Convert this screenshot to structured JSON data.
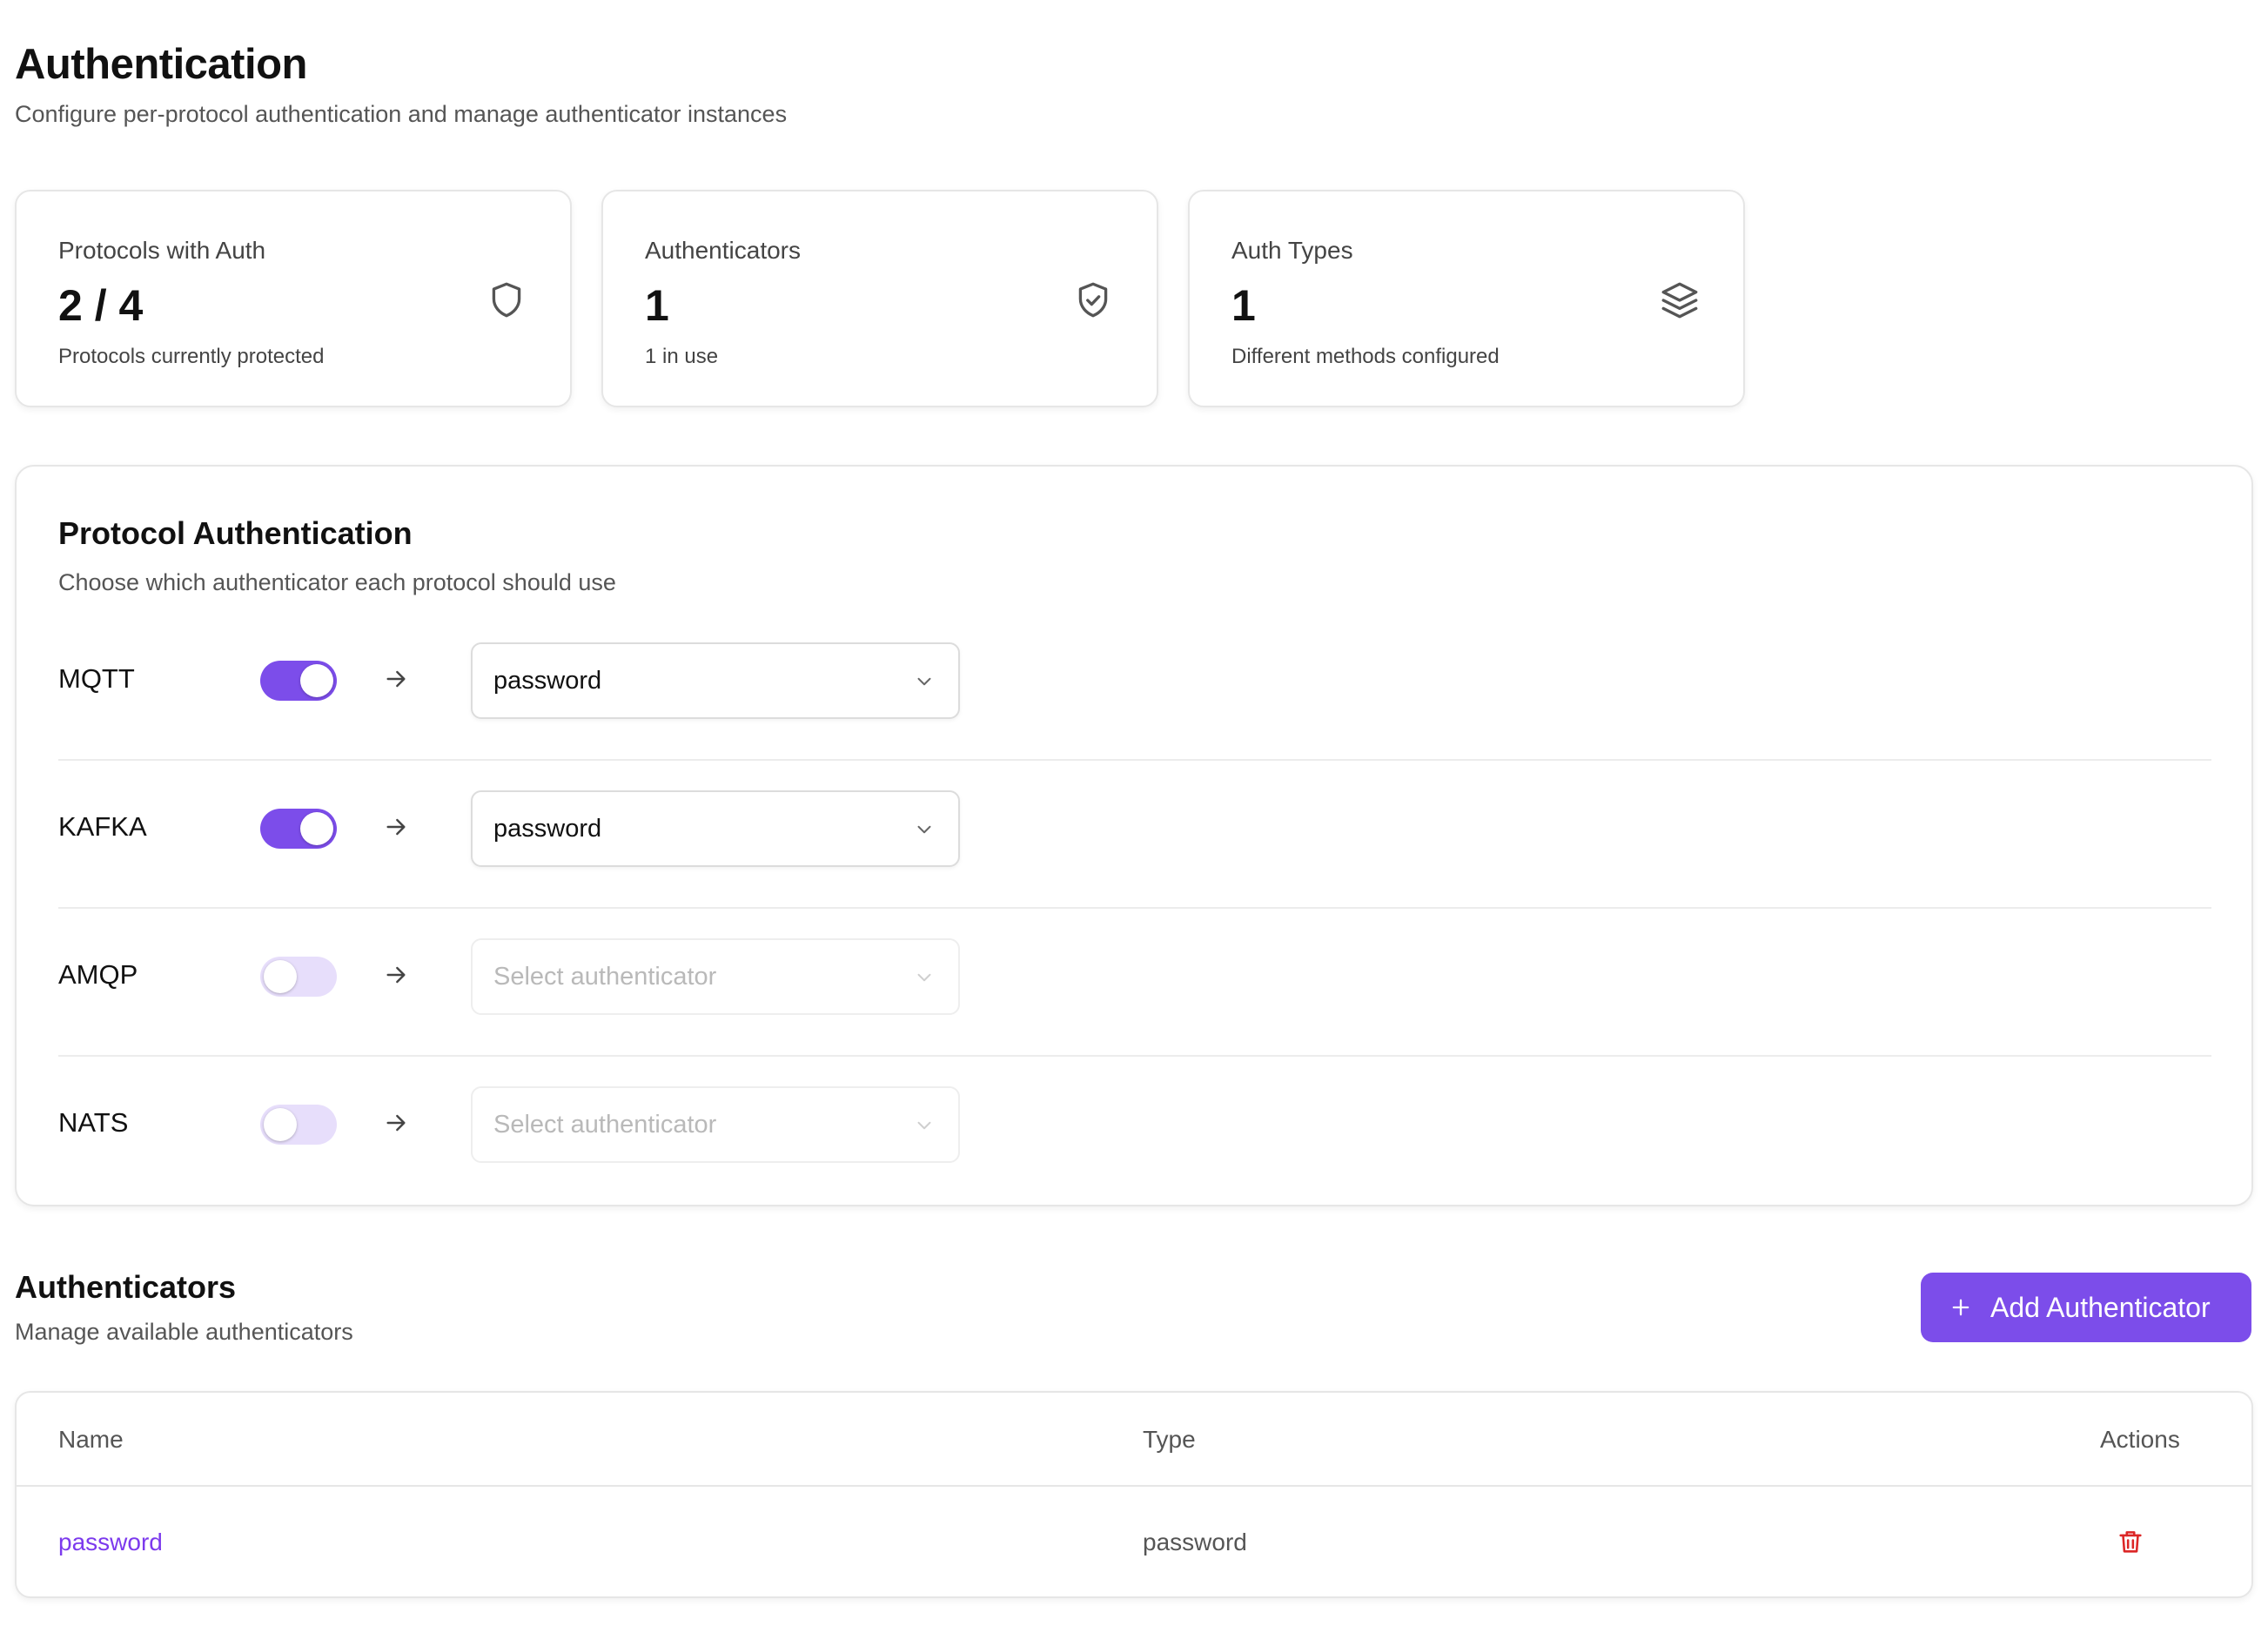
{
  "header": {
    "title": "Authentication",
    "subtitle": "Configure per-protocol authentication and manage authenticator instances"
  },
  "stats": [
    {
      "label": "Protocols with Auth",
      "value": "2 / 4",
      "description": "Protocols currently protected",
      "icon": "shield-icon"
    },
    {
      "label": "Authenticators",
      "value": "1",
      "description": "1 in use",
      "icon": "shield-check-icon"
    },
    {
      "label": "Auth Types",
      "value": "1",
      "description": "Different methods configured",
      "icon": "layers-icon"
    }
  ],
  "protocol_auth": {
    "title": "Protocol Authentication",
    "subtitle": "Choose which authenticator each protocol should use",
    "rows": [
      {
        "name": "MQTT",
        "enabled": true,
        "selected": "password",
        "placeholder": ""
      },
      {
        "name": "KAFKA",
        "enabled": true,
        "selected": "password",
        "placeholder": ""
      },
      {
        "name": "AMQP",
        "enabled": false,
        "selected": "",
        "placeholder": "Select authenticator"
      },
      {
        "name": "NATS",
        "enabled": false,
        "selected": "",
        "placeholder": "Select authenticator"
      }
    ]
  },
  "authenticators": {
    "title": "Authenticators",
    "subtitle": "Manage available authenticators",
    "add_button_label": "Add Authenticator",
    "columns": {
      "name": "Name",
      "type": "Type",
      "actions": "Actions"
    },
    "rows": [
      {
        "name": "password",
        "type": "password"
      }
    ]
  },
  "colors": {
    "accent": "#7c4dea",
    "toggle_off": "#e7defb",
    "link": "#7c3aed",
    "danger": "#dc2626"
  }
}
